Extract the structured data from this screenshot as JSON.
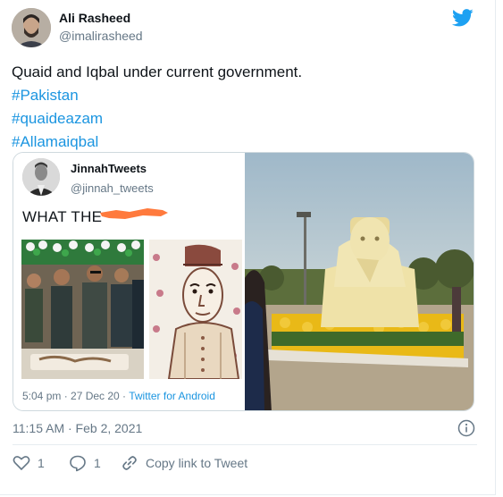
{
  "tweet": {
    "author_name": "Ali Rasheed",
    "author_handle": "@imalirasheed",
    "text_line": "Quaid and Iqbal under current government.",
    "hashtags": [
      "#Pakistan",
      "#quaideazam",
      "#Allamaiqbal"
    ],
    "timestamp": "11:15 AM · Feb 2, 2021",
    "likes": "1",
    "replies": "1",
    "copy_link_label": "Copy link to Tweet"
  },
  "quoted": {
    "author_name": "JinnahTweets",
    "author_handle": "@jinnah_tweets",
    "text": "WHAT THE",
    "time": "5:04 pm · 27 Dec 20 · ",
    "source": "Twitter for Android"
  },
  "colors": {
    "twitter_blue": "#1da1f2",
    "hashtag": "#1b95e0",
    "secondary_text": "#657786",
    "scribble": "#ff7a3d"
  },
  "icons": [
    "twitter-bird-icon",
    "info-icon",
    "heart-icon",
    "reply-icon",
    "link-icon"
  ]
}
